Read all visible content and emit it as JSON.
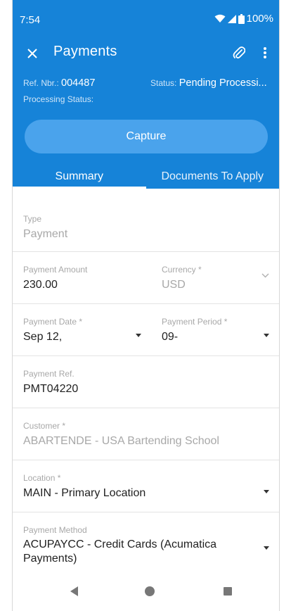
{
  "statusbar": {
    "time": "7:54",
    "battery": "100%"
  },
  "appbar": {
    "title": "Payments",
    "close_icon": "close-icon",
    "attach_icon": "paperclip-icon",
    "more_icon": "more-vert-icon"
  },
  "info": {
    "ref_label": "Ref. Nbr.:",
    "ref_value": "004487",
    "status_label": "Status:",
    "status_value": "Pending Processi...",
    "processing_label": "Processing Status:"
  },
  "capture_label": "Capture",
  "tabs": [
    {
      "label": "Summary"
    },
    {
      "label": "Documents To Apply"
    }
  ],
  "fields": {
    "type": {
      "label": "Type",
      "value": "Payment"
    },
    "amount": {
      "label": "Payment Amount",
      "value": "230.00"
    },
    "currency": {
      "label": "Currency *",
      "value": "USD"
    },
    "date": {
      "label": "Payment Date *",
      "value": "Sep 12,"
    },
    "period": {
      "label": "Payment Period *",
      "value": "09-"
    },
    "ref": {
      "label": "Payment Ref.",
      "value": "PMT04220"
    },
    "customer": {
      "label": "Customer *",
      "value": "ABARTENDE - USA Bartending School"
    },
    "location": {
      "label": "Location *",
      "value": "MAIN - Primary Location"
    },
    "method": {
      "label": "Payment Method",
      "value_line1": "ACUPAYCC - Credit Cards (Acumatica",
      "value_line2": "Payments)"
    }
  },
  "colors": {
    "primary": "#1683d8",
    "capture": "#4aa3ec"
  }
}
